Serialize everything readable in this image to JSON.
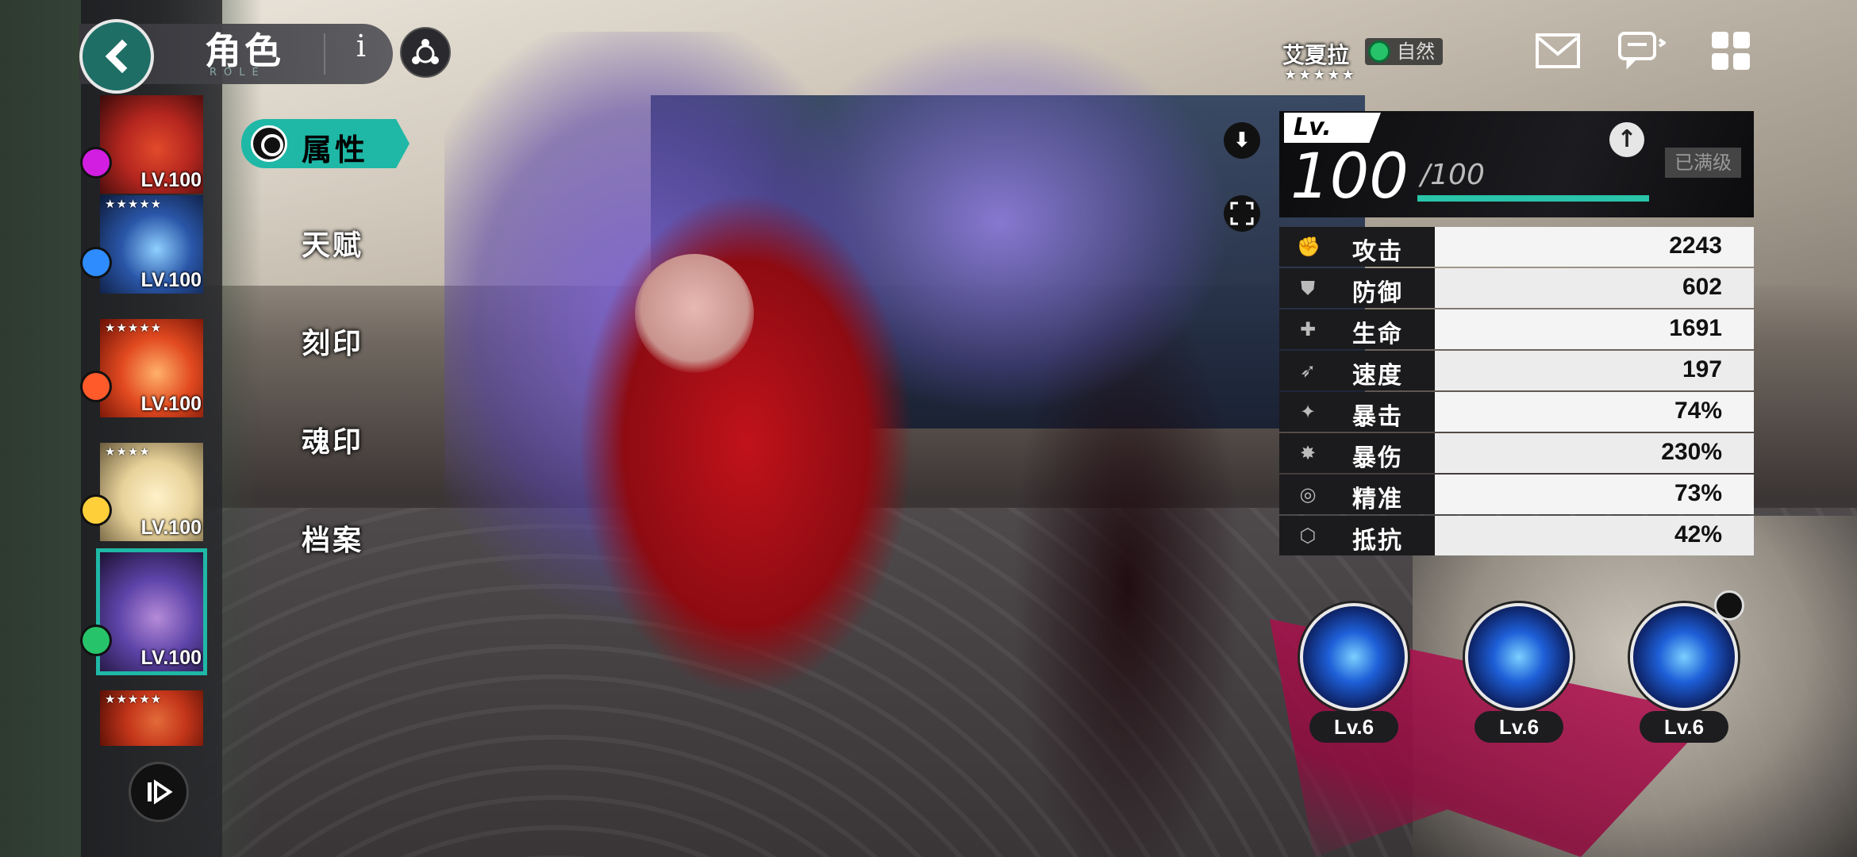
{
  "header": {
    "title": "角色",
    "subtitle": "ROLE",
    "info_label": "i"
  },
  "roster": [
    {
      "level": "LV.100",
      "element": "eye",
      "element_color": "#d21ee0",
      "stars": "",
      "art": [
        "#3b0a0a",
        "#b4261f",
        "#e24a2a"
      ]
    },
    {
      "level": "LV.100",
      "element": "water",
      "element_color": "#2f8cff",
      "stars": "★★★★★",
      "art": [
        "#0c1a3a",
        "#2a56a8",
        "#8fd0ff"
      ]
    },
    {
      "level": "LV.100",
      "element": "fire",
      "element_color": "#ff5a2a",
      "stars": "★★★★★",
      "art": [
        "#6b0f05",
        "#e24a20",
        "#ffb16a"
      ]
    },
    {
      "level": "LV.100",
      "element": "light",
      "element_color": "#ffcf3a",
      "stars": "★★★★",
      "art": [
        "#6a5b3c",
        "#e8d29a",
        "#fff1c9"
      ]
    },
    {
      "level": "LV.100",
      "element": "nature",
      "element_color": "#27c36a",
      "stars": "",
      "art": [
        "#1c1233",
        "#5d43a8",
        "#b58bd8"
      ],
      "selected": true
    },
    {
      "level": "",
      "element": "",
      "element_color": "",
      "stars": "★★★★★",
      "art": [
        "#5a0f06",
        "#c4361a",
        "#e36b3a"
      ]
    }
  ],
  "menu": {
    "active": "属性",
    "items": [
      "天赋",
      "刻印",
      "魂印",
      "档案"
    ]
  },
  "character": {
    "name": "艾夏拉",
    "element": "自然",
    "stars": "★★★★★"
  },
  "level": {
    "label": "Lv.",
    "current": "100",
    "max": "/100",
    "progress": 1.0,
    "maxed_label": "已满级"
  },
  "stats": [
    {
      "icon": "fist-icon",
      "glyph": "✊",
      "name": "攻击",
      "value": "2243"
    },
    {
      "icon": "shield-icon",
      "glyph": "⛊",
      "name": "防御",
      "value": "602"
    },
    {
      "icon": "life-icon",
      "glyph": "✚",
      "name": "生命",
      "value": "1691"
    },
    {
      "icon": "speed-icon",
      "glyph": "➶",
      "name": "速度",
      "value": "197"
    },
    {
      "icon": "crit-icon",
      "glyph": "✦",
      "name": "暴击",
      "value": "74%"
    },
    {
      "icon": "crit-damage-icon",
      "glyph": "✸",
      "name": "暴伤",
      "value": "230%"
    },
    {
      "icon": "accuracy-icon",
      "glyph": "◎",
      "name": "精准",
      "value": "73%"
    },
    {
      "icon": "resist-icon",
      "glyph": "⬡",
      "name": "抵抗",
      "value": "42%"
    }
  ],
  "skills": [
    {
      "level": "Lv.6"
    },
    {
      "level": "Lv.6"
    },
    {
      "level": "Lv.6"
    }
  ],
  "colors": {
    "accent": "#1fb8a6",
    "level_bar": "#29c4a9"
  }
}
